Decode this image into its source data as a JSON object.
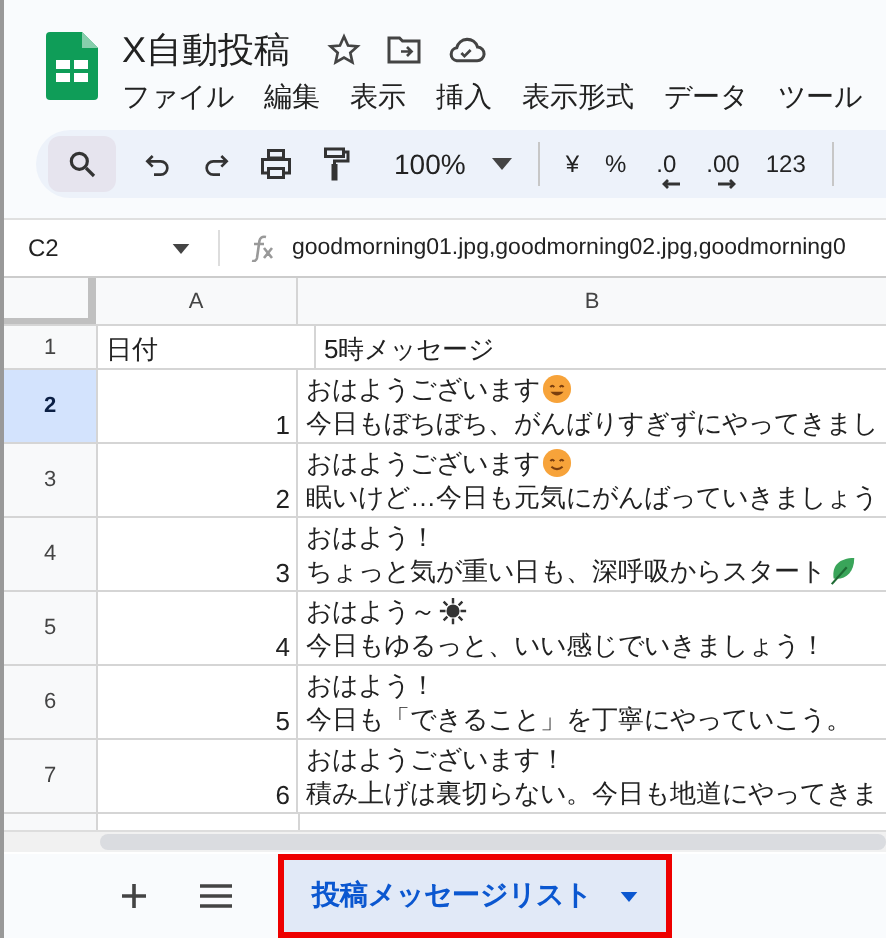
{
  "document": {
    "title": "X自動投稿"
  },
  "menu": [
    "ファイル",
    "編集",
    "表示",
    "挿入",
    "表示形式",
    "データ",
    "ツール"
  ],
  "toolbar": {
    "zoom": "100%",
    "format_buttons": [
      {
        "label": "¥",
        "kind": "plain"
      },
      {
        "label": "%",
        "kind": "plain"
      },
      {
        "label": ".0",
        "kind": "decrease"
      },
      {
        "label": ".00",
        "kind": "increase"
      },
      {
        "label": "123",
        "kind": "plain"
      }
    ]
  },
  "formula_bar": {
    "cell": "C2",
    "value": "goodmorning01.jpg,goodmorning02.jpg,goodmorning0"
  },
  "columns": [
    "A",
    "B"
  ],
  "header_row": {
    "number": "1",
    "cells": [
      "日付",
      "5時メッセージ"
    ]
  },
  "rows": [
    {
      "number": "2",
      "selected": true,
      "a": "1",
      "line1": "おはようございます",
      "line2": "今日もぼちぼち、がんばりすぎずにやってきまし"
    },
    {
      "number": "3",
      "selected": false,
      "a": "2",
      "line1": "おはようございます",
      "line2": "眠いけど…今日も元気にがんばっていきましょう"
    },
    {
      "number": "4",
      "selected": false,
      "a": "3",
      "line1": "おはよう！",
      "line2": "ちょっと気が重い日も、深呼吸からスタート"
    },
    {
      "number": "5",
      "selected": false,
      "a": "4",
      "line1": "おはよう～",
      "line2": "今日もゆるっと、いい感じでいきましょう！"
    },
    {
      "number": "6",
      "selected": false,
      "a": "5",
      "line1": "おはよう！",
      "line2": "今日も「できること」を丁寧にやっていこう。"
    },
    {
      "number": "7",
      "selected": false,
      "a": "6",
      "line1": "おはようございます！",
      "line2": "積み上げは裏切らない。今日も地道にやってきま"
    }
  ],
  "sheet_tabs": [
    {
      "label": "投稿メッセージリスト",
      "selected": true,
      "highlighted": true
    }
  ]
}
